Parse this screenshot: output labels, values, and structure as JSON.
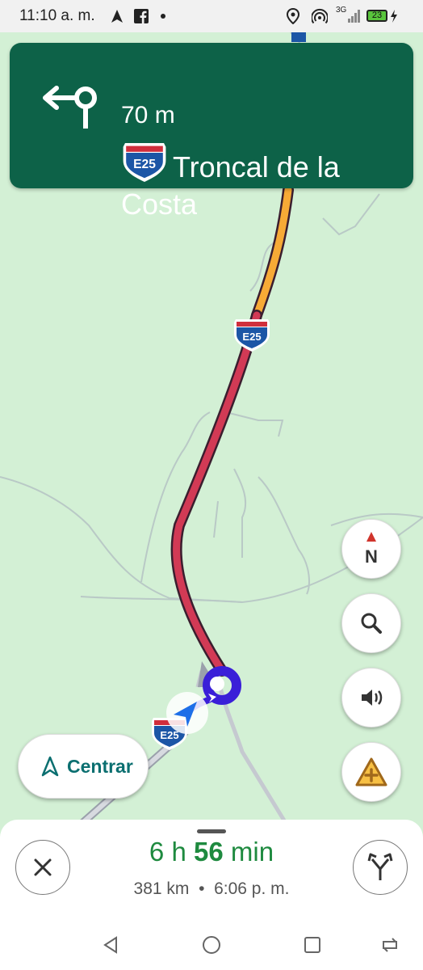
{
  "status_bar": {
    "time": "11:10 a. m.",
    "network": "3G",
    "battery": "23"
  },
  "banner": {
    "distance": "70 m",
    "shield": "E25",
    "street": "Troncal de la Costa"
  },
  "map": {
    "route_shield_1": "E25",
    "route_shield_2": "E25",
    "compass_label": "N"
  },
  "controls": {
    "recenter_label": "Centrar"
  },
  "trip": {
    "hours": "6",
    "h_unit": "h",
    "minutes": "56",
    "min_unit": "min",
    "distance": "381 km",
    "separator": "•",
    "arrival": "6:06 p. m."
  },
  "colors": {
    "banner_green": "#0d6248",
    "map_background": "#d3f0d5",
    "traffic_red": "#d23a55",
    "traffic_orange": "#f7aa36",
    "route_blue": "#3a1fd8",
    "eta_green": "#1e8a3f"
  },
  "icons": [
    "roundabout-turn-icon",
    "compass-icon",
    "search-icon",
    "volume-icon",
    "report-incident-icon",
    "close-icon",
    "alternate-routes-icon",
    "navigation-arrow-icon"
  ]
}
